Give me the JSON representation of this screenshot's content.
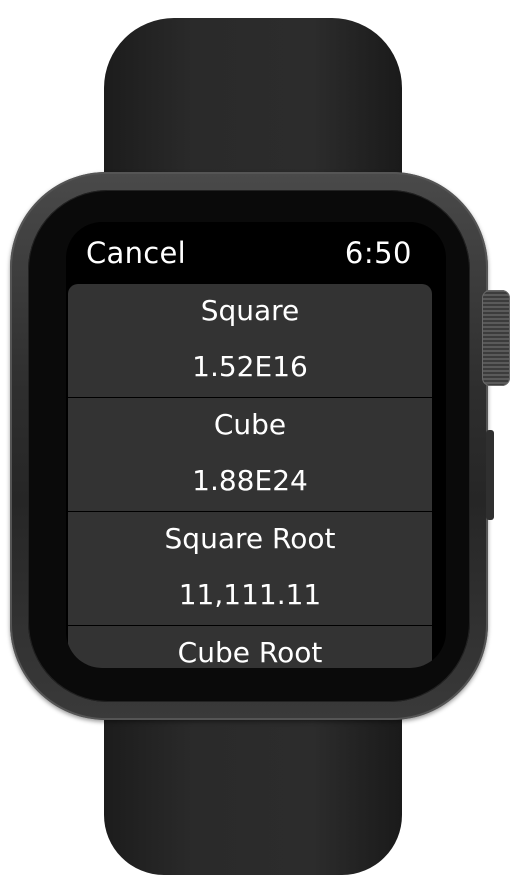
{
  "header": {
    "cancel_label": "Cancel",
    "time": "6:50"
  },
  "results": [
    {
      "label": "Square",
      "value": "1.52E16"
    },
    {
      "label": "Cube",
      "value": "1.88E24"
    },
    {
      "label": "Square Root",
      "value": "11,111.11"
    },
    {
      "label": "Cube Root",
      "value": ""
    }
  ],
  "colors": {
    "screen_background": "#000000",
    "row_background": "#333333",
    "text": "#ffffff"
  }
}
